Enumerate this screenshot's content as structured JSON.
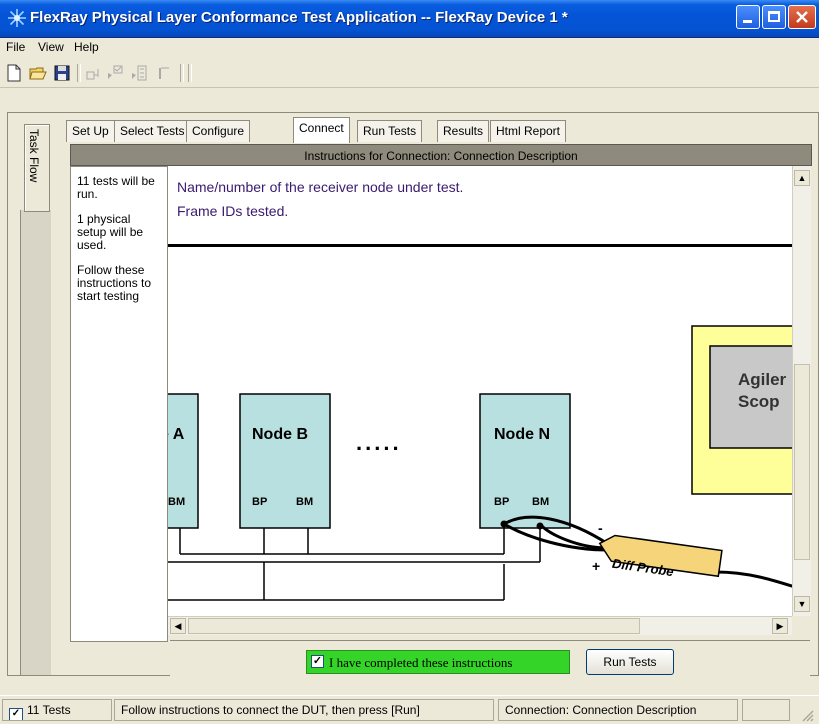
{
  "window": {
    "title": "FlexRay Physical Layer Conformance Test Application -- FlexRay Device 1 *"
  },
  "menu": {
    "items": [
      "File",
      "View",
      "Help"
    ]
  },
  "toolbar": {
    "icons": [
      "new-file-icon",
      "open-folder-icon",
      "save-icon",
      "connect-icon",
      "run-check-icon",
      "tests-icon",
      "pause-icon",
      "stop-icon"
    ]
  },
  "taskflow": {
    "label": "Task Flow"
  },
  "tabs": [
    "Set Up",
    "Select Tests",
    "Configure",
    "Connect",
    "Run Tests",
    "Results",
    "Html Report"
  ],
  "active_tab": "Connect",
  "panel": {
    "header": "Instructions for Connection: Connection Description"
  },
  "info": {
    "tests_run": "11 tests will be run.",
    "setup": "1 physical setup will be used.",
    "follow": "Follow these instructions to start testing"
  },
  "instructions": {
    "line1": "Name/number of the receiver node under test.",
    "line2": "Frame IDs tested."
  },
  "diagram": {
    "node_a": "e A",
    "node_b": "Node B",
    "node_n": "Node N",
    "ellipsis": ".....",
    "bp": "BP",
    "bm": "BM",
    "probe": "Diff Probe",
    "minus": "-",
    "plus": "+",
    "scope_line1": "Agiler",
    "scope_line2": "Scop"
  },
  "confirm": {
    "label": "I have completed these instructions",
    "checked": true
  },
  "run_button": "Run Tests",
  "status": {
    "tests": "11 Tests",
    "message": "Follow instructions to connect the DUT, then press [Run]",
    "connection": "Connection: Connection Description"
  },
  "colors": {
    "titlebar": "#0554d8",
    "node_fill": "#b9e0e0",
    "scope_fill": "#ffff99",
    "scope_inner": "#c8c8c8",
    "probe_fill": "#f6d57a",
    "confirm_green": "#34d428",
    "instruction_text": "#3a1a6e"
  }
}
